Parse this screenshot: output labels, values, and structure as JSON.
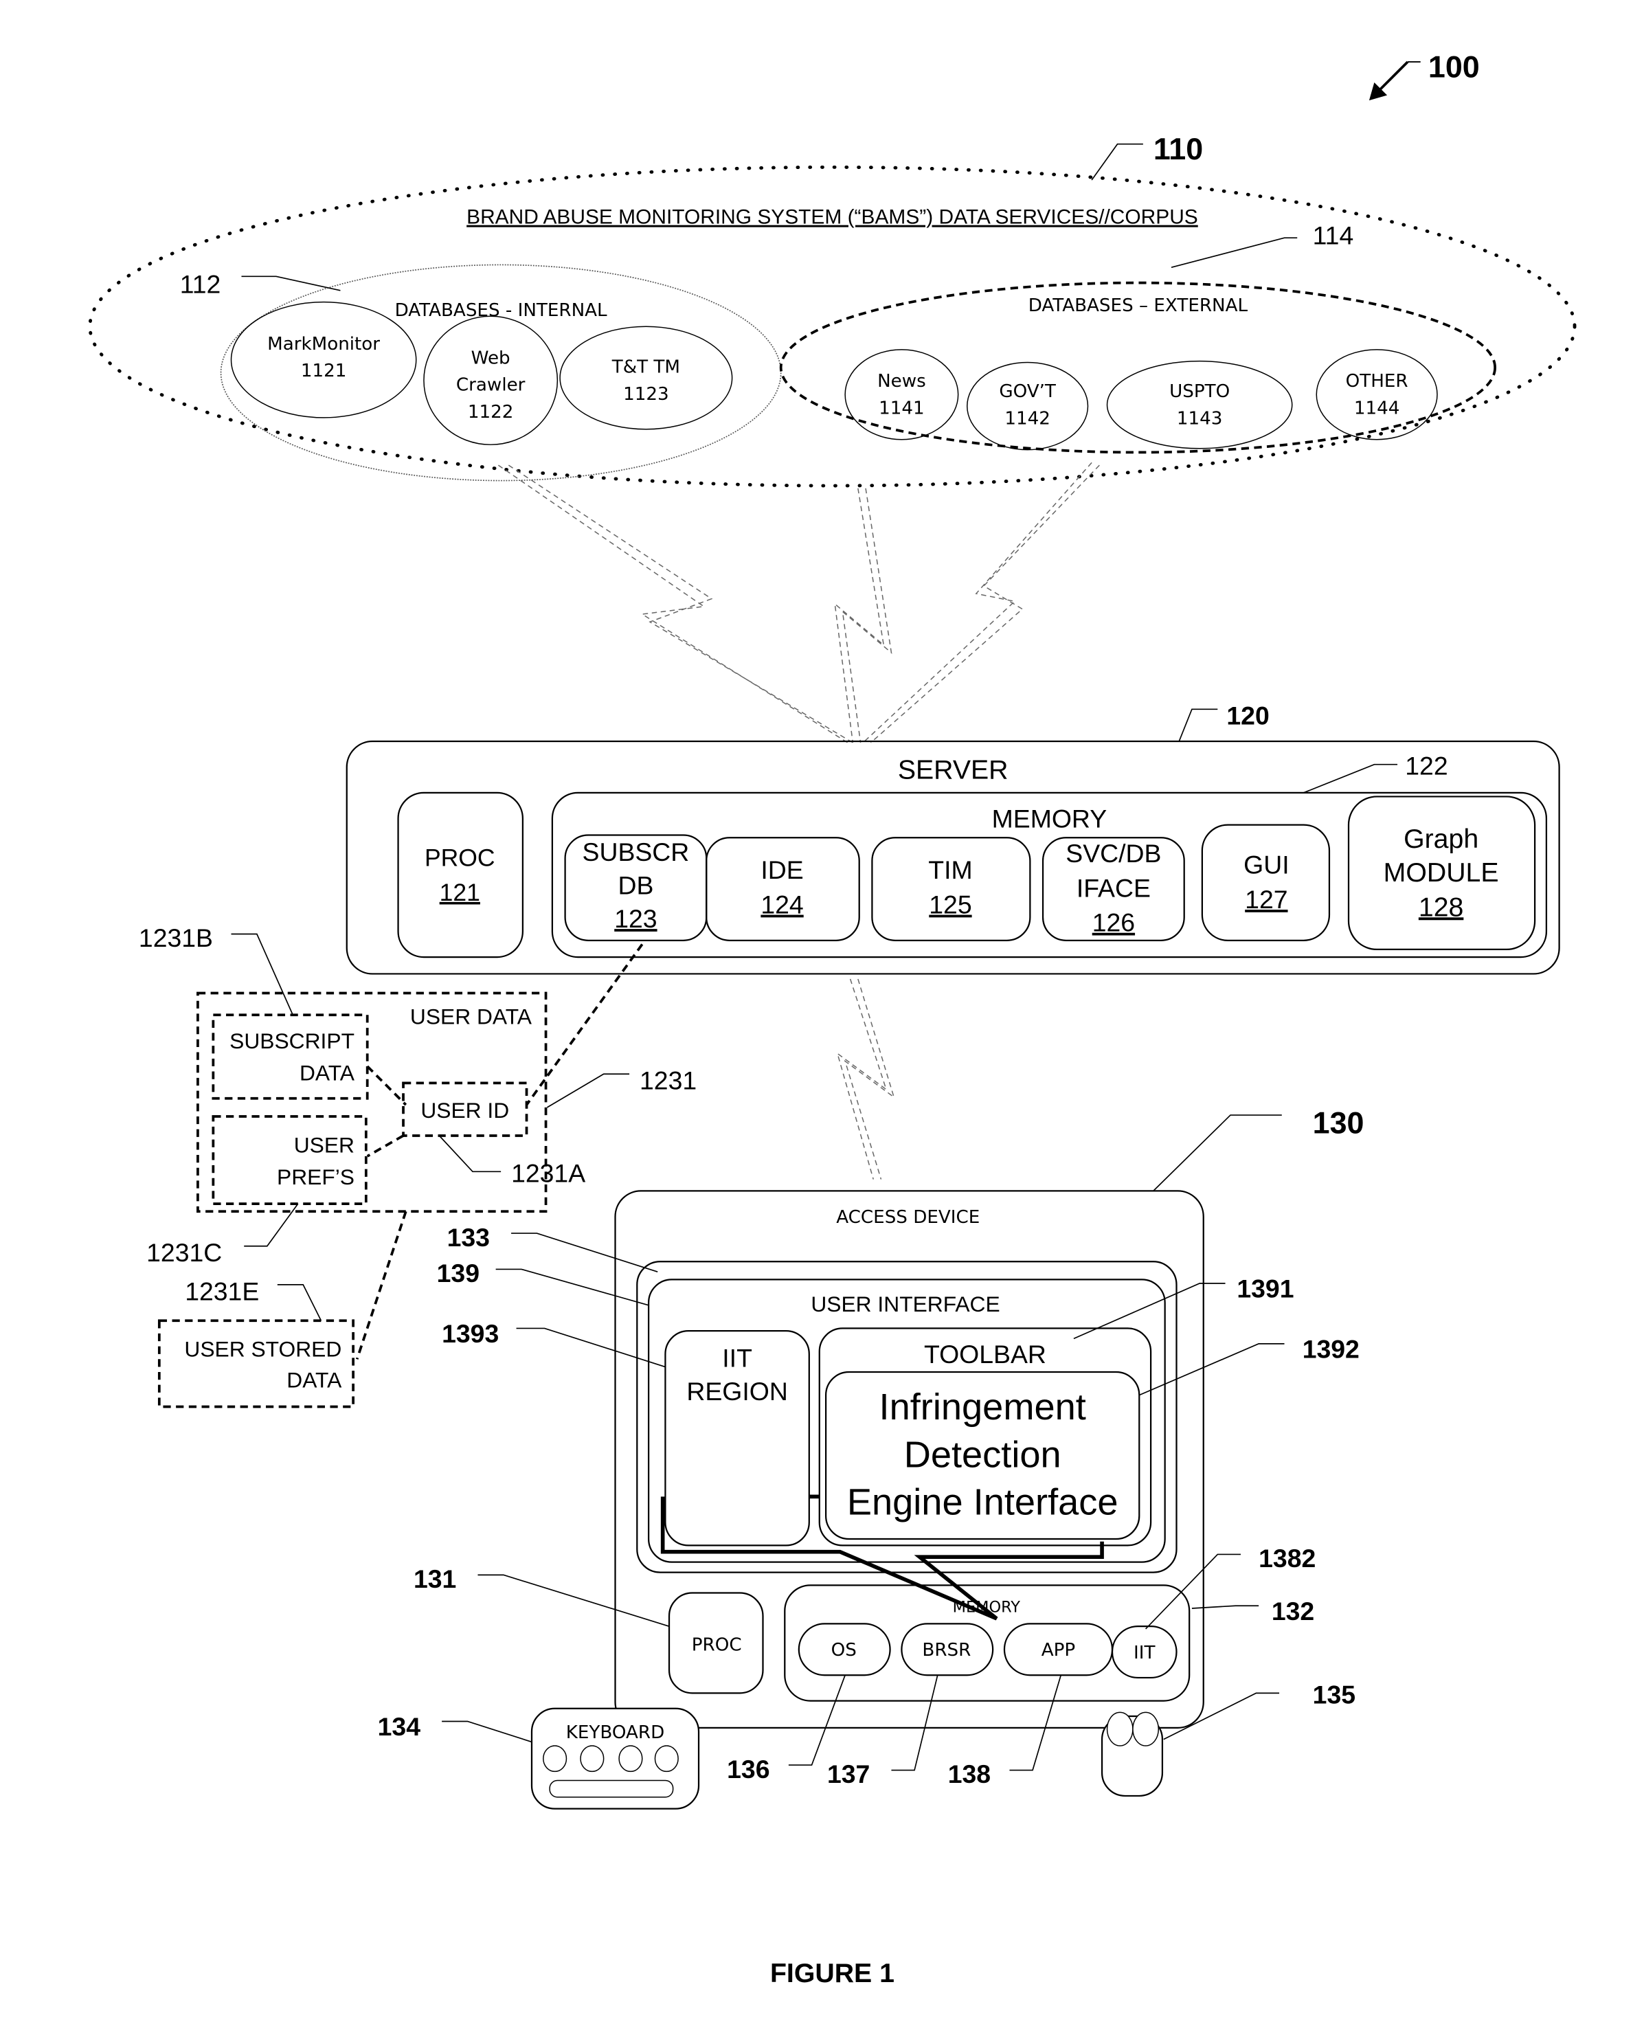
{
  "figure": {
    "ref": "100",
    "caption": "FIGURE 1"
  },
  "corpus": {
    "ref": "110",
    "title": "BRAND ABUSE MONITORING SYSTEM (“BAMS”) DATA SERVICES//CORPUS",
    "internal": {
      "ref": "112",
      "title": "DATABASES - INTERNAL",
      "items": [
        {
          "lines": [
            "MarkMonitor",
            "1121"
          ]
        },
        {
          "lines": [
            "Web",
            "Crawler",
            "1122"
          ]
        },
        {
          "lines": [
            "T&T TM",
            "1123"
          ]
        }
      ]
    },
    "external": {
      "ref": "114",
      "title": "DATABASES – EXTERNAL",
      "items": [
        {
          "lines": [
            "News",
            "1141"
          ]
        },
        {
          "lines": [
            "GOV’T",
            "1142"
          ]
        },
        {
          "lines": [
            "USPTO",
            "1143"
          ]
        },
        {
          "lines": [
            "OTHER",
            "1144"
          ]
        }
      ]
    }
  },
  "server": {
    "ref": "120",
    "title": "SERVER",
    "proc": {
      "label": "PROC",
      "num": "121"
    },
    "memory": {
      "ref": "122",
      "title": "MEMORY",
      "modules": [
        {
          "lines": [
            "SUBSCR",
            "DB"
          ],
          "num": "123"
        },
        {
          "lines": [
            "IDE"
          ],
          "num": "124"
        },
        {
          "lines": [
            "TIM"
          ],
          "num": "125"
        },
        {
          "lines": [
            "SVC/DB",
            "IFACE"
          ],
          "num": "126"
        },
        {
          "lines": [
            "GUI"
          ],
          "num": "127"
        },
        {
          "lines": [
            "Graph",
            "MODULE"
          ],
          "num": "128"
        }
      ]
    }
  },
  "user_data": {
    "ref": "1231",
    "title": "USER DATA",
    "subscript": {
      "ref": "1231B",
      "lines": [
        "SUBSCRIPT",
        "DATA"
      ]
    },
    "user_id": {
      "ref": "1231A",
      "label": "USER ID"
    },
    "prefs": {
      "ref": "1231C",
      "lines": [
        "USER",
        "PREF’S"
      ]
    },
    "stored": {
      "ref": "1231E",
      "lines": [
        "USER STORED",
        "DATA"
      ]
    }
  },
  "access_device": {
    "ref": "130",
    "title": "ACCESS DEVICE",
    "display_ref": "133",
    "ui": {
      "ref": "139",
      "title": "USER INTERFACE",
      "iit_region": {
        "ref": "1393",
        "lines": [
          "IIT",
          "REGION"
        ]
      },
      "toolbar": {
        "ref": "1391",
        "title": "TOOLBAR"
      },
      "engine": {
        "ref": "1392",
        "lines": [
          "Infringement",
          "Detection",
          "Engine Interface"
        ]
      }
    },
    "proc": {
      "ref": "131",
      "label": "PROC"
    },
    "memory": {
      "ref": "132",
      "title": "MEMORY",
      "items": [
        {
          "label": "OS",
          "ref": "136"
        },
        {
          "label": "BRSR",
          "ref": "137"
        },
        {
          "label": "APP",
          "ref": "138"
        },
        {
          "label": "IIT",
          "ref": "1382"
        }
      ]
    },
    "keyboard": {
      "ref": "134",
      "label": "KEYBOARD"
    },
    "mouse": {
      "ref": "135"
    }
  }
}
